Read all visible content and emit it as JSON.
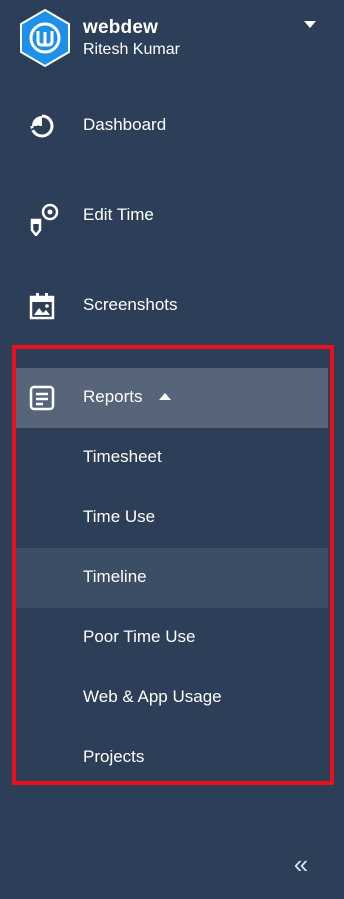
{
  "header": {
    "brand": "webdew",
    "user": "Ritesh Kumar",
    "logo_letter": "W",
    "dropdown_icon": "caret-down-icon"
  },
  "colors": {
    "sidebar_bg": "#2c3e58",
    "reports_bg": "#56657a",
    "active_bg": "#3c4d66",
    "highlight_border": "#e8101a",
    "logo_blue": "#1e90e8"
  },
  "nav": {
    "dashboard": {
      "label": "Dashboard",
      "icon": "pie-chart-icon"
    },
    "edit_time": {
      "label": "Edit Time",
      "icon": "edit-time-icon"
    },
    "screenshots": {
      "label": "Screenshots",
      "icon": "calendar-image-icon"
    },
    "reports": {
      "label": "Reports",
      "icon": "report-document-icon",
      "expanded": true,
      "items": [
        {
          "label": "Timesheet"
        },
        {
          "label": "Time Use"
        },
        {
          "label": "Timeline"
        },
        {
          "label": "Poor Time Use"
        },
        {
          "label": "Web & App Usage"
        },
        {
          "label": "Projects"
        }
      ]
    }
  },
  "footer": {
    "collapse_glyph": "«",
    "collapse_icon": "double-chevron-left-icon"
  }
}
